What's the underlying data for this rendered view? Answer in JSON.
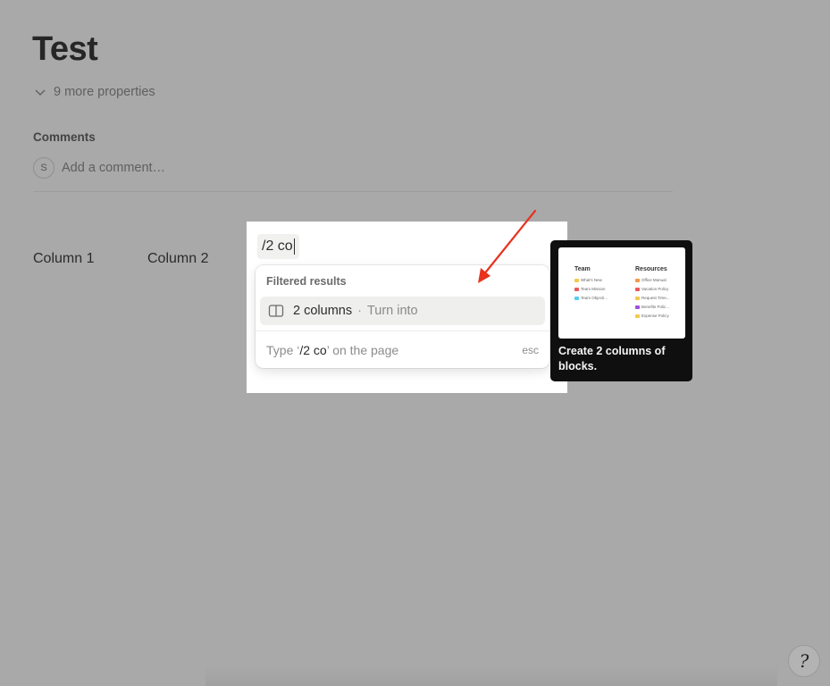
{
  "page": {
    "title": "Test",
    "more_properties": "9 more properties",
    "comments_label": "Comments",
    "comment_avatar": "S",
    "comment_placeholder": "Add a comment…"
  },
  "columns": [
    "Column 1",
    "Column 2"
  ],
  "slash_command": {
    "query": "/2 co"
  },
  "menu": {
    "header": "Filtered results",
    "item_label": "2 columns",
    "item_separator": "·",
    "item_sub": "Turn into",
    "footer_prefix": "Type ‘",
    "footer_query": "/2 co",
    "footer_suffix": "’ on the page",
    "footer_esc": "esc"
  },
  "tooltip": {
    "preview_col1_head": "Team",
    "preview_col1_items": [
      "What's New",
      "Team Mission",
      "Team Objecti..."
    ],
    "preview_col2_head": "Resources",
    "preview_col2_items": [
      "Office Manual",
      "Vacation Policy",
      "Request Time...",
      "Benefits Polic...",
      "Expense Policy"
    ],
    "text": "Create 2 columns of blocks."
  },
  "help": {
    "glyph": "?"
  },
  "colors": {
    "overlay": "#a9a9a9",
    "arrow": "#e8321e",
    "tooltip_bg": "#0f0f0f"
  },
  "icons": {
    "chevron": "chevron-down-icon",
    "columns": "columns-icon",
    "arrow": "annotation-arrow-icon",
    "help": "help-icon"
  }
}
